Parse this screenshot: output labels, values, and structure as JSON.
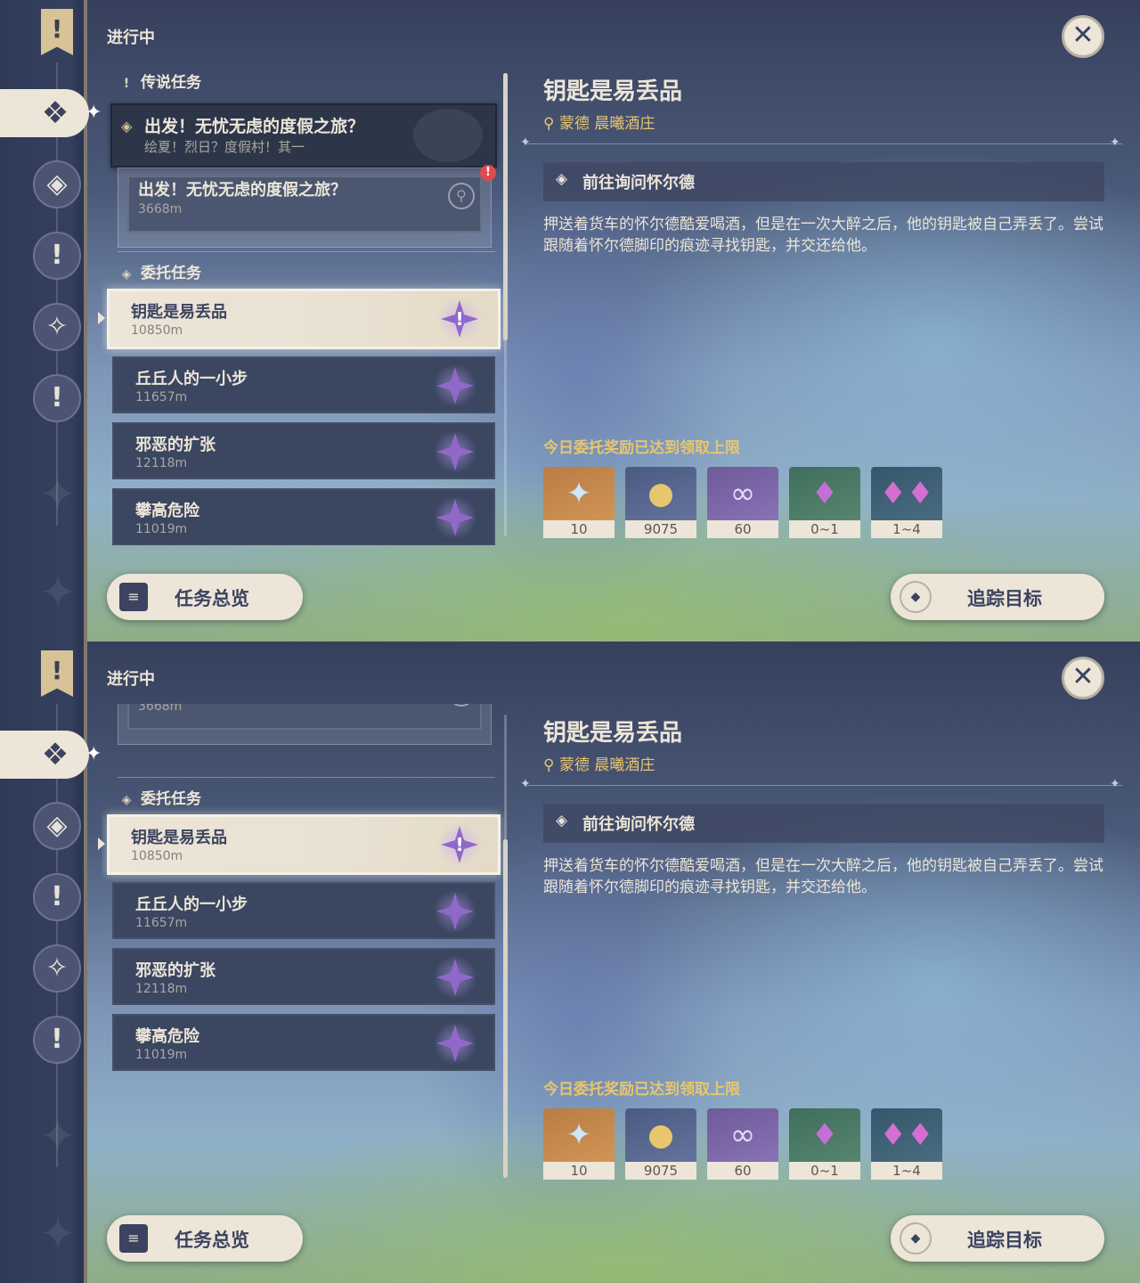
{
  "status_title": "进行中",
  "legend_section": {
    "title": "传说任务"
  },
  "legend_card": {
    "name": "出发！无忧无虑的度假之旅？",
    "subtitle": "绘夏！烈日？度假村！其一"
  },
  "legend_sub": {
    "name": "出发！无忧无虑的度假之旅？",
    "distance": "3668m",
    "alert_icon": "!"
  },
  "commission_section": {
    "title": "委托任务"
  },
  "commissions": [
    {
      "name": "钥匙是易丢品",
      "distance": "10850m"
    },
    {
      "name": "丘丘人的一小步",
      "distance": "11657m"
    },
    {
      "name": "邪恶的扩张",
      "distance": "12118m"
    },
    {
      "name": "攀高危险",
      "distance": "11019m"
    }
  ],
  "detail": {
    "title": "钥匙是易丢品",
    "location": "蒙德 晨曦酒庄",
    "objective": "前往询问怀尔德",
    "description": "押送着货车的怀尔德酷爱喝酒，但是在一次大醉之后，他的钥匙被自己弄丢了。尝试跟随着怀尔德脚印的痕迹寻找钥匙，并交还给他。",
    "reward_notice": "今日委托奖励已达到领取上限",
    "rewards": [
      {
        "icon": "primogem-icon",
        "count": "10"
      },
      {
        "icon": "mora-icon",
        "count": "9075"
      },
      {
        "icon": "companionship-exp-icon",
        "count": "60"
      },
      {
        "icon": "crystal-ore-icon",
        "count": "0~1"
      },
      {
        "icon": "crystal-chunk-icon",
        "count": "1~4"
      }
    ]
  },
  "buttons": {
    "overview": "任务总览",
    "track": "追踪目标"
  },
  "colors": {
    "accent_gold": "#e8c66d",
    "cream": "#ece5d8",
    "commission_star": "#9168c9",
    "alert_red": "#e04a4a"
  }
}
